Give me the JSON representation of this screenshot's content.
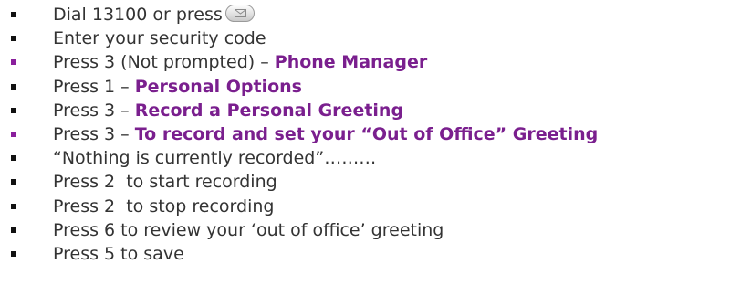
{
  "instructions": [
    {
      "bullet_color": "#111111",
      "text": "Dial 13100 or press",
      "highlight": "",
      "has_icon": true,
      "icon": "envelope-icon"
    },
    {
      "bullet_color": "#111111",
      "text": "Enter your security code",
      "highlight": ""
    },
    {
      "bullet_color": "#8a1f9c",
      "text": "Press 3 (Not prompted) – ",
      "highlight": "Phone Manager"
    },
    {
      "bullet_color": "#111111",
      "text": "Press 1 – ",
      "highlight": "Personal Options"
    },
    {
      "bullet_color": "#111111",
      "text": "Press 3 – ",
      "highlight": "Record a Personal Greeting"
    },
    {
      "bullet_color": "#8a1f9c",
      "text": "Press 3 – ",
      "highlight": "To record and set your “Out of Office” Greeting"
    },
    {
      "bullet_color": "#111111",
      "text": "“Nothing is currently recorded”………",
      "highlight": ""
    },
    {
      "bullet_color": "#111111",
      "text": "Press 2  to start recording",
      "highlight": ""
    },
    {
      "bullet_color": "#111111",
      "text": "Press 2  to stop recording",
      "highlight": ""
    },
    {
      "bullet_color": "#111111",
      "text": "Press 6 to review your ‘out of office’ greeting",
      "highlight": ""
    },
    {
      "bullet_color": "#111111",
      "text": "Press 5 to save",
      "highlight": ""
    }
  ],
  "colors": {
    "body_text": "#333333",
    "highlight_text": "#7a1f8e",
    "bullet_default": "#111111",
    "bullet_accent": "#8a1f9c"
  }
}
